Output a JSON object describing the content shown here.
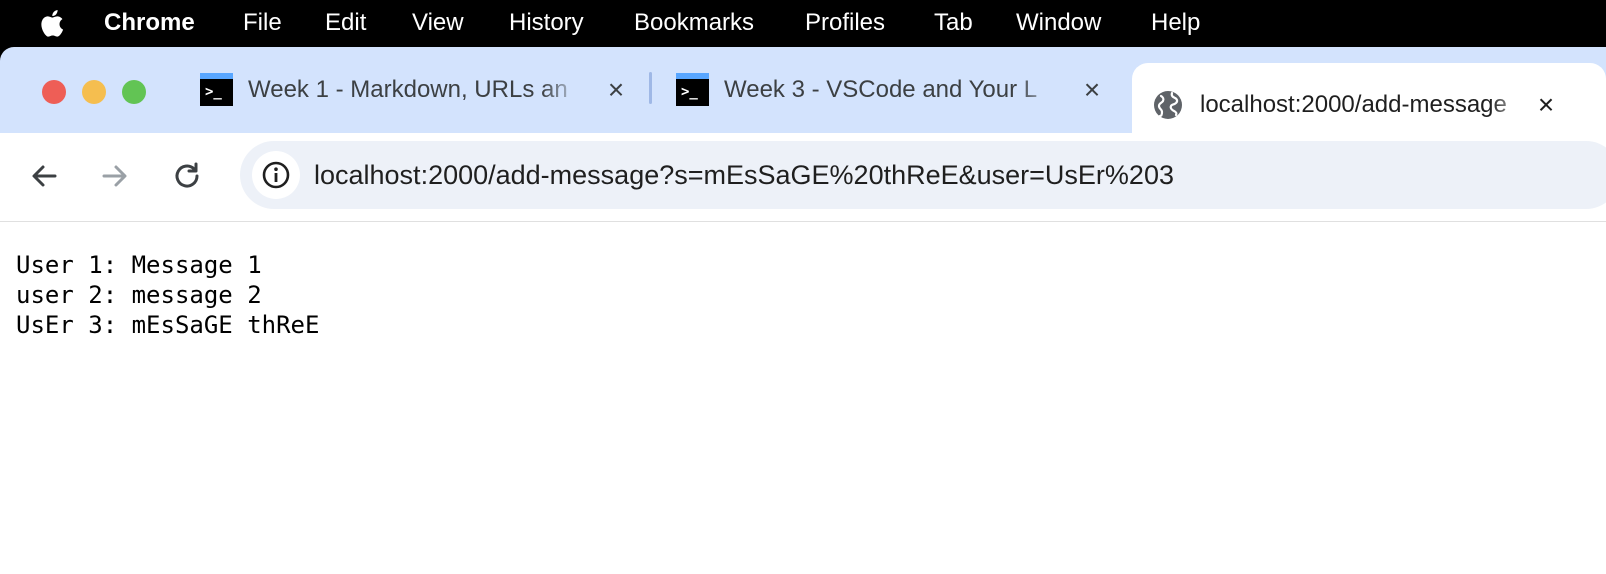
{
  "menubar": {
    "icon": "apple-icon",
    "app_name": "Chrome",
    "items": [
      "File",
      "Edit",
      "View",
      "History",
      "Bookmarks",
      "Profiles",
      "Tab",
      "Window",
      "Help"
    ]
  },
  "tabs": [
    {
      "title": "Week 1 - Markdown, URLs an",
      "icon": "terminal-icon"
    },
    {
      "title": "Week 3 - VSCode and Your L",
      "icon": "terminal-icon"
    },
    {
      "title": "localhost:2000/add-message",
      "icon": "globe-icon",
      "active": true
    }
  ],
  "toolbar": {
    "url": "localhost:2000/add-message?s=mEsSaGE%20thReE&user=UsEr%203"
  },
  "page": {
    "lines": [
      "User 1: Message 1",
      "user 2: message 2",
      "UsEr 3: mEsSaGE thReE"
    ]
  },
  "colors": {
    "tabstrip": "#d3e3fd",
    "omnibox": "#edf1f8",
    "close_red": "#ee5e56",
    "minimize_yellow": "#f5be4f",
    "zoom_green": "#62c454"
  }
}
